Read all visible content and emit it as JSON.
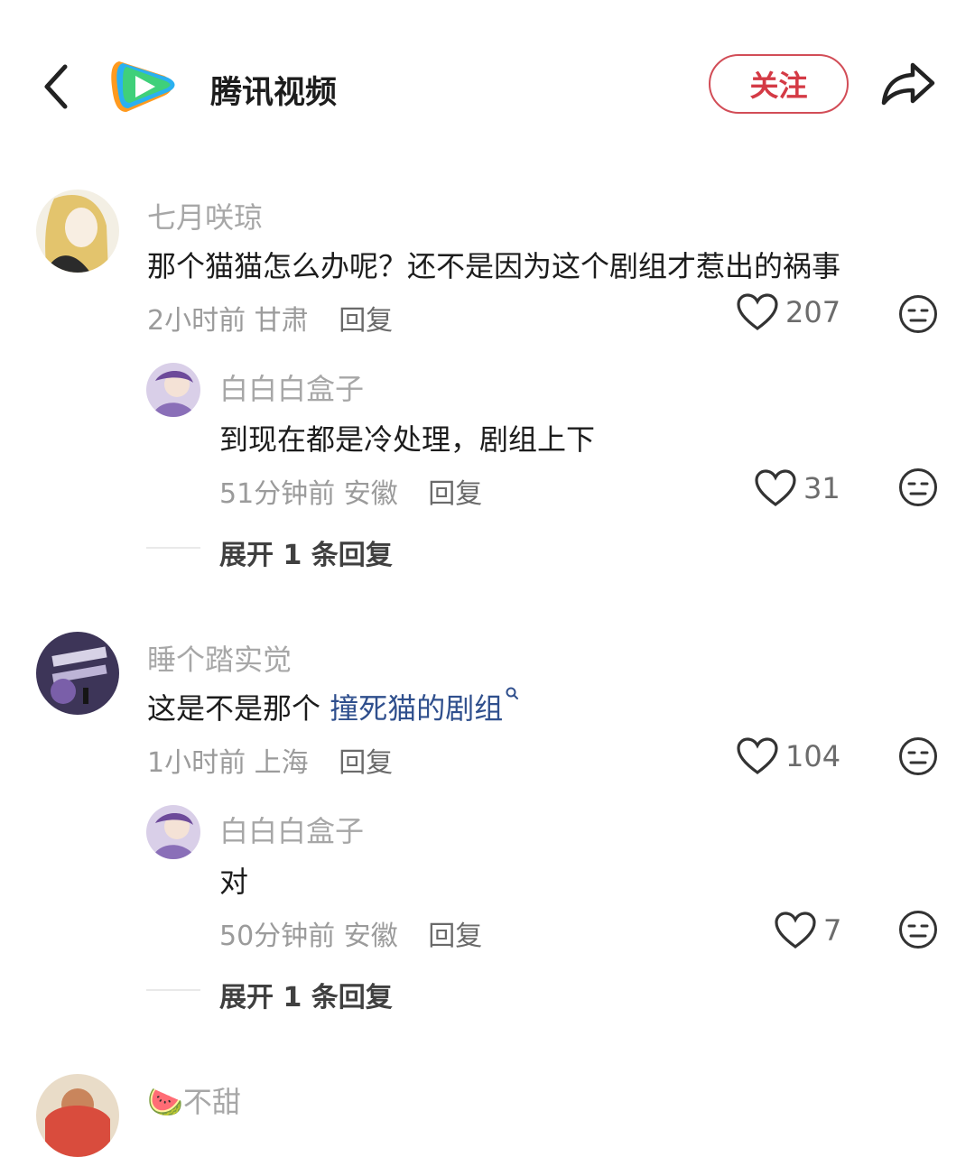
{
  "header": {
    "channel_name": "腾讯视频",
    "follow_label": "关注",
    "icons": [
      "back-arrow-icon",
      "tencent-video-logo",
      "share-icon"
    ]
  },
  "comments": [
    {
      "user": "七月咲琼",
      "text": "那个猫猫怎么办呢？还不是因为这个剧组才惹出的祸事",
      "time": "2小时前",
      "location": "甘肃",
      "reply_label": "回复",
      "likes": "207",
      "replies": [
        {
          "user": "白白白盒子",
          "text": "到现在都是冷处理，剧组上下",
          "time": "51分钟前",
          "location": "安徽",
          "reply_label": "回复",
          "likes": "31"
        }
      ],
      "expand_label": "展开 1 条回复"
    },
    {
      "user": "睡个踏实觉",
      "text_prefix": "这是不是那个 ",
      "text_link": "撞死猫的剧组",
      "time": "1小时前",
      "location": "上海",
      "reply_label": "回复",
      "likes": "104",
      "replies": [
        {
          "user": "白白白盒子",
          "text": "对",
          "time": "50分钟前",
          "location": "安徽",
          "reply_label": "回复",
          "likes": "7"
        }
      ],
      "expand_label": "展开 1 条回复"
    },
    {
      "user": "🍉不甜"
    }
  ],
  "colors": {
    "follow_red": "#d43a45",
    "link_blue": "#2f4f8d",
    "username_gray": "#a7a7a7"
  }
}
